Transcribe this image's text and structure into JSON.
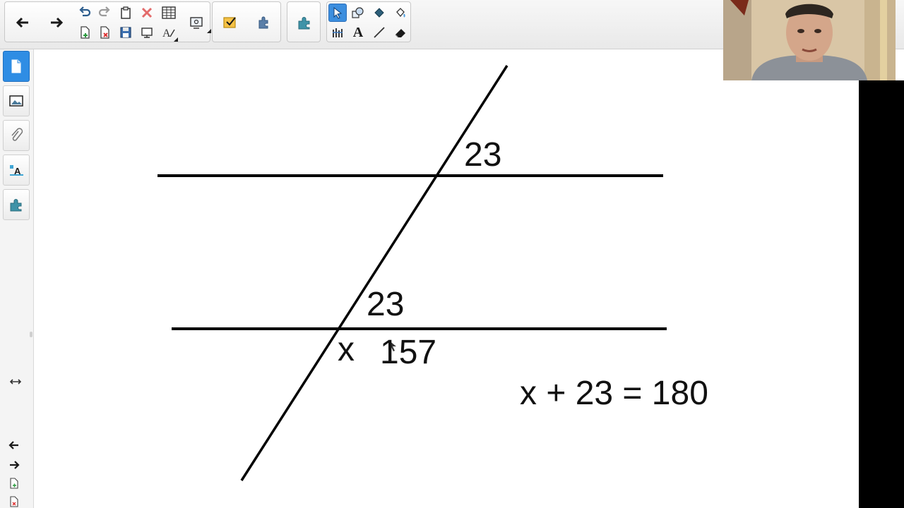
{
  "toolbar": {
    "icons": {
      "back": "arrow-left-icon",
      "forward": "arrow-right-icon",
      "undo": "undo-icon",
      "redo": "redo-icon",
      "paste": "clipboard-icon",
      "delete": "delete-x-icon",
      "table": "table-icon",
      "screen_shade": "screen-shade-icon",
      "select": "pointer-icon",
      "shapes": "shapes-icon",
      "fill": "fill-icon",
      "pen": "pen-icon",
      "text": "text-icon",
      "line": "line-icon",
      "eraser": "eraser-icon",
      "addon": "puzzle-icon"
    },
    "text_tool_glyph": "A",
    "accent_color": "#3c8ede"
  },
  "side_tabs": {
    "items": [
      "page-sorter",
      "gallery",
      "attachments",
      "properties",
      "add-ons"
    ],
    "active": "page-sorter",
    "accent_color": "#2f8de4"
  },
  "canvas": {
    "angle_labels": {
      "upper_right": "23",
      "lower_upper": "23",
      "lower_left": "x",
      "lower_right": "157"
    },
    "equation": "x + 23 = 180",
    "line_color": "#000000"
  },
  "webcam": {
    "description": "presenter-video"
  }
}
